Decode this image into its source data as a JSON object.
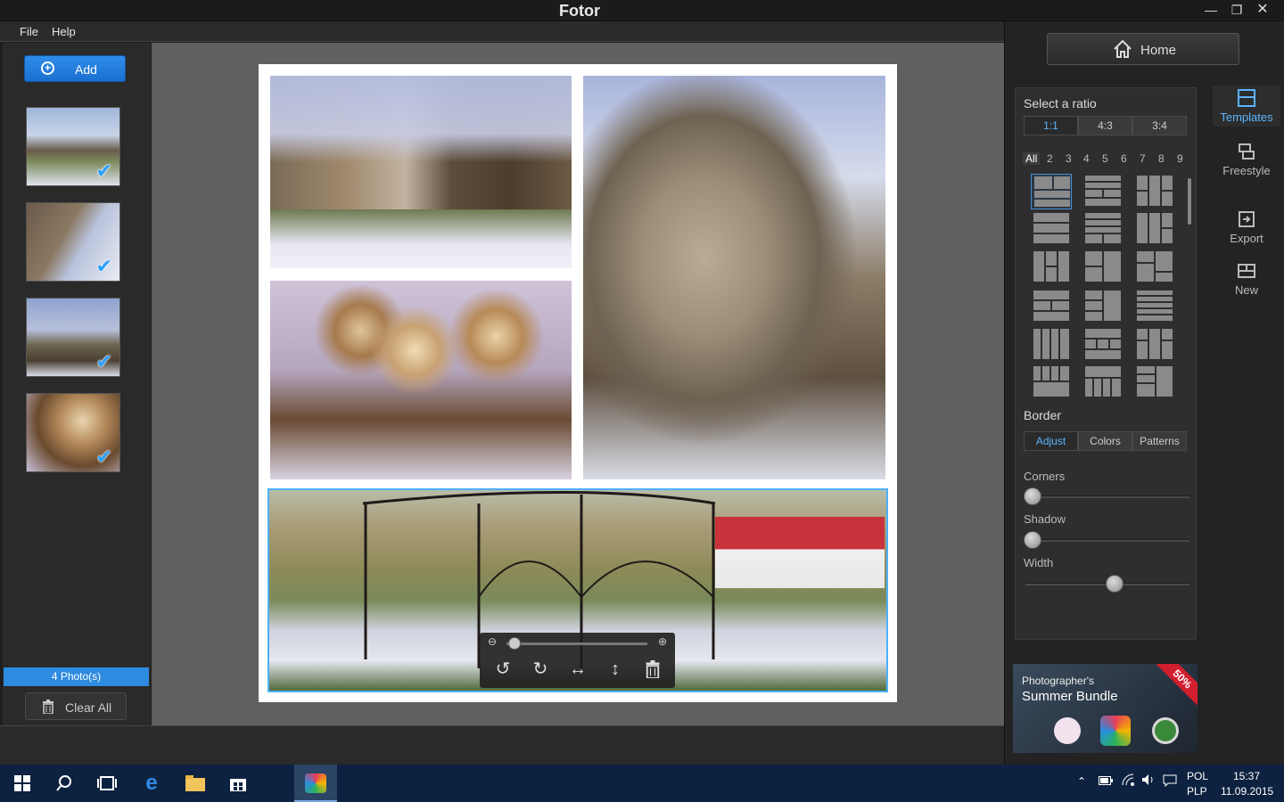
{
  "window": {
    "title": "Fotor"
  },
  "menu": {
    "file": "File",
    "help": "Help"
  },
  "left_panel": {
    "add_label": "Add",
    "photo_count": "4 Photo(s)",
    "clear_all_label": "Clear All"
  },
  "header": {
    "home_label": "Home"
  },
  "templates": {
    "select_ratio_label": "Select a ratio",
    "ratios": [
      "1:1",
      "4:3",
      "3:4"
    ],
    "selected_ratio": "1:1",
    "count_filters": [
      "All",
      "2",
      "3",
      "4",
      "5",
      "6",
      "7",
      "8",
      "9"
    ],
    "selected_filter": "All"
  },
  "border": {
    "heading": "Border",
    "tabs": [
      "Adjust",
      "Colors",
      "Patterns"
    ],
    "selected_tab": "Adjust",
    "corners_label": "Corners",
    "corners_value": 0,
    "shadow_label": "Shadow",
    "shadow_value": 0,
    "width_label": "Width",
    "width_value": 0.5
  },
  "side_tabs": {
    "templates": "Templates",
    "freestyle": "Freestyle",
    "export": "Export",
    "new": "New",
    "active": "Templates"
  },
  "promo": {
    "line1": "Photographer's",
    "line2": "Summer Bundle",
    "badge": "50%"
  },
  "image_toolbar": {
    "zoom_value": 0.05
  },
  "taskbar": {
    "language": "POL",
    "layout": "PLP",
    "time": "15:37",
    "date": "11.09.2015"
  },
  "colors": {
    "accent": "#2d8be0",
    "selection_outline": "#4ab0ff",
    "taskbar": "#0d2240"
  }
}
